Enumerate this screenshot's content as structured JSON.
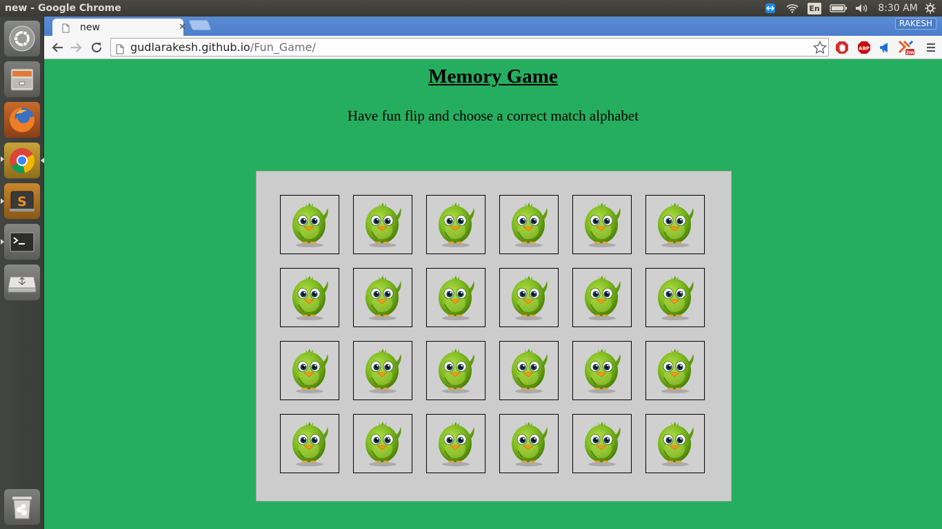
{
  "os_panel": {
    "window_title": "new - Google Chrome",
    "language": "En",
    "clock": "8:30 AM"
  },
  "launcher": {
    "items": [
      "ubuntu-dash",
      "files",
      "firefox",
      "chrome",
      "sublime-text",
      "terminal",
      "usb-drive",
      "trash"
    ]
  },
  "browser": {
    "tab_title": "new",
    "profile_name": "RAKESH",
    "url_host": "gudlarakesh.github.io",
    "url_path": "/Fun_Game/",
    "extension_badge": "2m"
  },
  "page": {
    "title": "Memory Game",
    "subtitle": "Have fun flip and choose a correct match alphabet",
    "background_color": "#26ae60",
    "board_color": "#cccccc"
  },
  "game": {
    "rows": 4,
    "columns": 6,
    "cards": [
      "bird-card-back",
      "bird-card-back",
      "bird-card-back",
      "bird-card-back",
      "bird-card-back",
      "bird-card-back",
      "bird-card-back",
      "bird-card-back",
      "bird-card-back",
      "bird-card-back",
      "bird-card-back",
      "bird-card-back",
      "bird-card-back",
      "bird-card-back",
      "bird-card-back",
      "bird-card-back",
      "bird-card-back",
      "bird-card-back",
      "bird-card-back",
      "bird-card-back",
      "bird-card-back",
      "bird-card-back",
      "bird-card-back",
      "bird-card-back"
    ]
  }
}
